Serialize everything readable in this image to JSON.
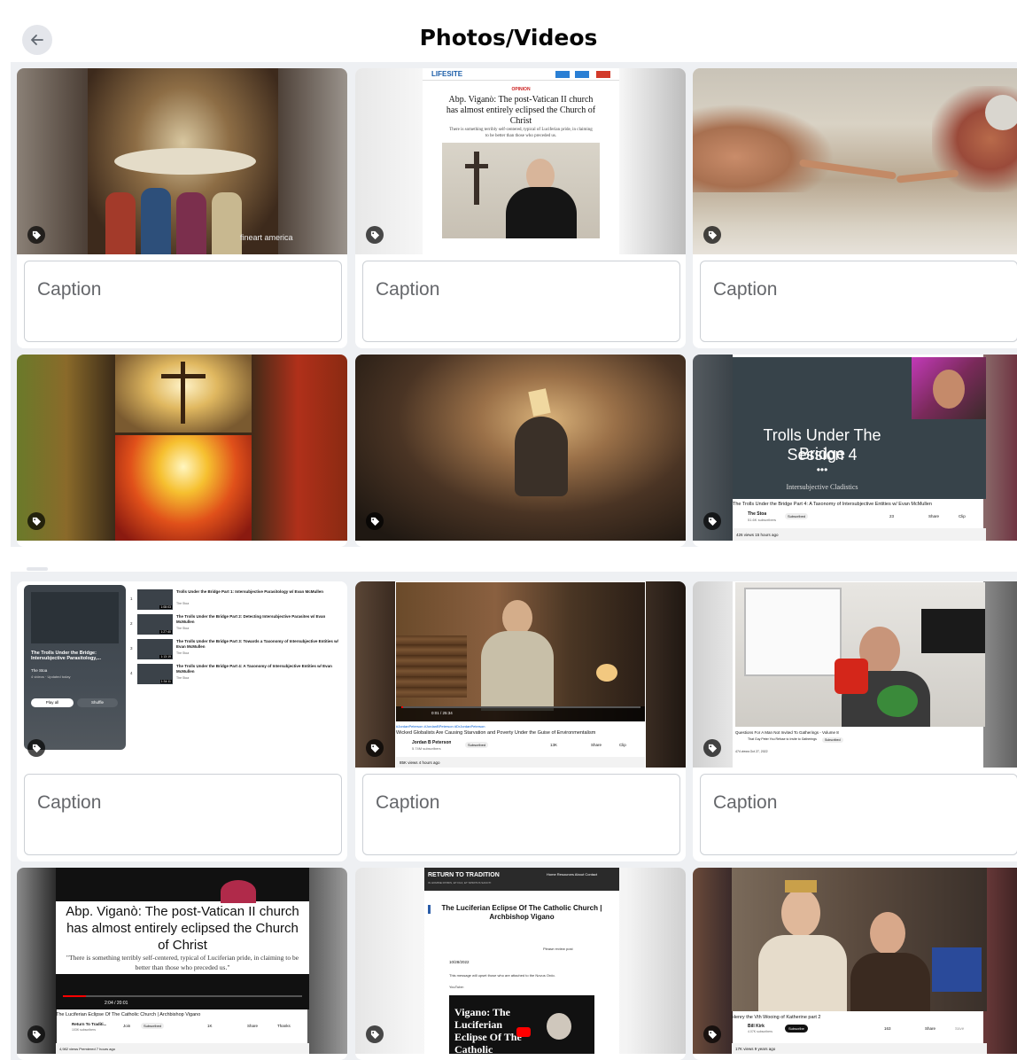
{
  "header": {
    "title": "Photos/Videos",
    "back_icon": "arrow-left-icon"
  },
  "caption_placeholder": "Caption",
  "watermark": "fineart america",
  "items": [
    {
      "id": 1
    },
    {
      "id": 2,
      "site": "LIFESITE",
      "kicker": "OPINION",
      "headline": "Abp. Viganò: The post-Vatican II church has almost entirely eclipsed the Church of Christ",
      "quote": "There is something terribly self-centered, typical of Luciferian pride, in claiming to be better than those who preceded us."
    },
    {
      "id": 3
    },
    {
      "id": 4
    },
    {
      "id": 5
    },
    {
      "id": 6,
      "slide_title_1": "Trolls Under The Bridge",
      "slide_title_2": "Session 4",
      "slide_sub": "Intersubjective Cladistics",
      "video_title": "The Trolls Under the Bridge Part 4: A Taxonomy of Intersubjective Entities w/ Evan McMullen",
      "channel": "The Stoa",
      "subs": "51.6K subscribers",
      "subscribed": "Subscribed",
      "views": "426 views  15 hours ago",
      "likes": "23",
      "share": "Share",
      "clip": "Clip"
    },
    {
      "id": 7,
      "playlist_title": "The Trolls Under the Bridge: Intersubjective Parasitology,...",
      "playlist_channel": "The Stoa",
      "playlist_meta": "4 videos · Updated today",
      "play_all": "Play all",
      "shuffle": "Shuffle",
      "videos": [
        {
          "n": "1",
          "title": "Trolls Under the Bridge Part 1: Intersubjective Parasitology w/ Evan McMullen",
          "ch": "The Stoa",
          "dur": "1:08:03"
        },
        {
          "n": "2",
          "title": "The Trolls Under the Bridge Part 2: Detecting Intersubjective Parasites w/ Evan McMullen",
          "ch": "The Stoa",
          "dur": "1:27:40"
        },
        {
          "n": "3",
          "title": "The Trolls Under the Bridge Part 3: Towards a Taxonomy of Intersubjective Entities w/ Evan McMullen",
          "ch": "The Stoa",
          "dur": "1:13:19"
        },
        {
          "n": "4",
          "title": "The Trolls Under the Bridge Part 4: A Taxonomy of Intersubjective Entities w/ Evan McMullen",
          "ch": "The Stoa",
          "dur": "1:34:11"
        }
      ]
    },
    {
      "id": 8,
      "hashtags": "#JordanPeterson #JordanBPeterson #DrJordanPeterson",
      "video_title": "Wicked Globalists Are Causing Starvation and Poverty Under the Guise of Environmentalism",
      "channel": "Jordan B Peterson",
      "subs": "5.74M subscribers",
      "subscribed": "Subscribed",
      "likes": "13K",
      "share": "Share",
      "clip": "Clip",
      "views": "85K views  4 hours ago",
      "time": "0:01 / 25:34"
    },
    {
      "id": 9,
      "video_title": "Questions For A Man Not Invited To Gatherings - Volume 8",
      "channel": "That Guy Peter You Refuse to Invite to Gatherings",
      "subscribed": "Subscribed",
      "views": "474 views  Oct 27, 2022"
    },
    {
      "id": 10,
      "headline": "Abp. Viganò: The post-Vatican II church has almost entirely eclipsed the Church of Christ",
      "quote": "\"There is something terribly self-centered, typical of Luciferian pride, in claiming to be better than those who preceded us.\"",
      "time": "2:04 / 20:01",
      "video_title": "The Luciferian Eclipse Of The Catholic Church | Archbishop Vigano",
      "channel": "Return To Traditi...",
      "subs": "103K subscribers",
      "join": "Join",
      "subscribed": "Subscribed",
      "likes": "1K",
      "share": "Share",
      "thanks": "Thanks",
      "views": "4,982 views  Premiered 7 hours ago"
    },
    {
      "id": 11,
      "site": "RETURN TO TRADITION",
      "tagline": "IN HOMINE PATRIS, ET FILII, ET SPIRITUS SANCTI",
      "nav": "Home  Resources  About  Contact",
      "headline": "The Luciferian Eclipse Of The Catholic Church | Archbishop Vigano",
      "review": "Please review post",
      "date": "10/28/2022",
      "body": "This message will upset those who are attached to the Novus Ordo.",
      "youtube": "YouTube:",
      "embed_title": "Vigano: The Luciferian Eclipse Of The Catholic"
    },
    {
      "id": 12,
      "video_title": "Henry the Vth Wooing of Katherine part 2",
      "channel": "Bill Kirk",
      "subs": "4.07K subscribers",
      "subscribe": "Subscribe",
      "likes": "163",
      "share": "Share",
      "save": "Save",
      "views": "17K views  9 years ago"
    }
  ]
}
